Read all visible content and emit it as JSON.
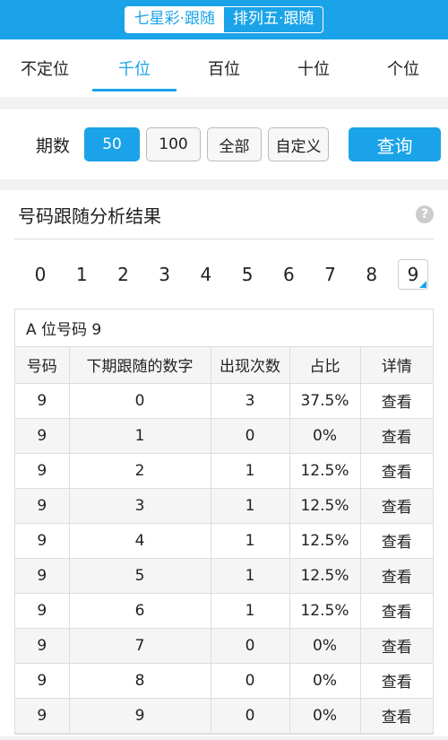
{
  "header": {
    "segments": [
      {
        "label": "七星彩·跟随",
        "active": true
      },
      {
        "label": "排列五·跟随",
        "active": false
      }
    ]
  },
  "tabs": [
    {
      "label": "不定位",
      "active": false
    },
    {
      "label": "千位",
      "active": true
    },
    {
      "label": "百位",
      "active": false
    },
    {
      "label": "十位",
      "active": false
    },
    {
      "label": "个位",
      "active": false
    }
  ],
  "filter": {
    "label": "期数",
    "options": [
      "50",
      "100",
      "全部",
      "自定义"
    ],
    "selected": "50",
    "query_label": "查询"
  },
  "result": {
    "title": "号码跟随分析结果",
    "help_icon": "question-icon",
    "digits": [
      "0",
      "1",
      "2",
      "3",
      "4",
      "5",
      "6",
      "7",
      "8",
      "9"
    ],
    "selected_digit": "9",
    "caption": "A 位号码 9",
    "columns": [
      "号码",
      "下期跟随的数字",
      "出现次数",
      "占比",
      "详情"
    ],
    "rows": [
      [
        "9",
        "0",
        "3",
        "37.5%",
        "查看"
      ],
      [
        "9",
        "1",
        "0",
        "0%",
        "查看"
      ],
      [
        "9",
        "2",
        "1",
        "12.5%",
        "查看"
      ],
      [
        "9",
        "3",
        "1",
        "12.5%",
        "查看"
      ],
      [
        "9",
        "4",
        "1",
        "12.5%",
        "查看"
      ],
      [
        "9",
        "5",
        "1",
        "12.5%",
        "查看"
      ],
      [
        "9",
        "6",
        "1",
        "12.5%",
        "查看"
      ],
      [
        "9",
        "7",
        "0",
        "0%",
        "查看"
      ],
      [
        "9",
        "8",
        "0",
        "0%",
        "查看"
      ],
      [
        "9",
        "9",
        "0",
        "0%",
        "查看"
      ]
    ]
  },
  "colors": {
    "accent": "#1aa3e8"
  }
}
